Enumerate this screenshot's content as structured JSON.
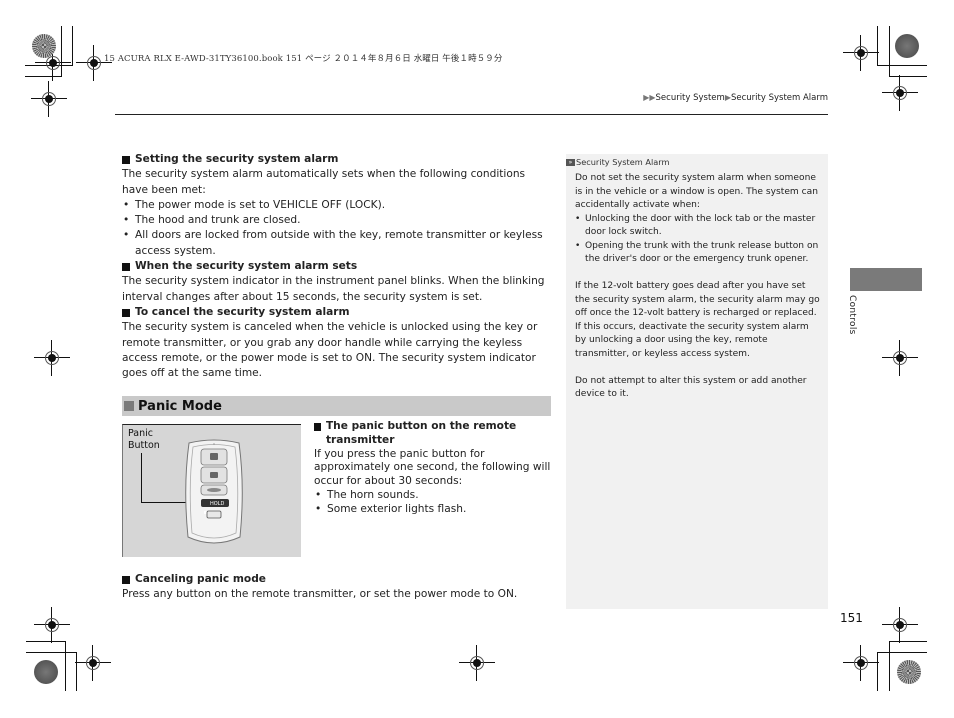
{
  "print_header": "15 ACURA RLX E-AWD-31TY36100.book  151 ページ  ２０１４年８月６日  水曜日  午後１時５９分",
  "breadcrumb": {
    "items": [
      "Security System",
      "Security System Alarm"
    ],
    "arrow_icon": "double-triangle-right"
  },
  "main": {
    "sections": [
      {
        "heading": "Setting the security system alarm",
        "body": "The security system alarm automatically sets when the following conditions have been met:",
        "bullets": [
          "The power mode is set to VEHICLE OFF (LOCK).",
          "The hood and trunk are closed.",
          "All doors are locked from outside with the key, remote transmitter or keyless access system."
        ]
      },
      {
        "heading": "When the security system alarm sets",
        "body": "The security system indicator in the instrument panel blinks. When the blinking interval changes after about 15 seconds, the security system is set."
      },
      {
        "heading": "To cancel the security system alarm",
        "body": "The security system is canceled when the vehicle is unlocked using the key or remote transmitter, or you grab any door handle while carrying the keyless access remote, or the power mode is set to ON. The security system indicator goes off at the same time."
      }
    ],
    "panic_mode": {
      "title": "Panic Mode",
      "figure": {
        "label_line1": "Panic",
        "label_line2": "Button",
        "hold_label": "HOLD"
      },
      "panic_button": {
        "heading": "The panic button on the remote transmitter",
        "body": "If you press the panic button for approximately one second, the following will occur for about 30 seconds:",
        "bullets": [
          "The horn sounds.",
          "Some exterior lights flash."
        ]
      },
      "canceling": {
        "heading": "Canceling panic mode",
        "body": "Press any button on the remote transmitter, or set the power mode to ON."
      }
    }
  },
  "note": {
    "title": "Security System Alarm",
    "para1": "Do not set the security system alarm when someone is in the vehicle or a window is open. The system can accidentally activate when:",
    "bullets": [
      "Unlocking the door with the lock tab or the master door lock switch.",
      "Opening the trunk with the trunk release button on the driver's door or the emergency trunk opener."
    ],
    "para2": "If the 12-volt battery goes dead after you have set the security system alarm, the security alarm may go off once the 12-volt battery is recharged or replaced.",
    "para3": "If this occurs, deactivate the security system alarm by unlocking a door using the key, remote transmitter, or keyless access system.",
    "para4": "Do not attempt to alter this system or add another device to it."
  },
  "side_tab": {
    "label": "Controls",
    "color": "#7a7a7a"
  },
  "page_number": "151"
}
